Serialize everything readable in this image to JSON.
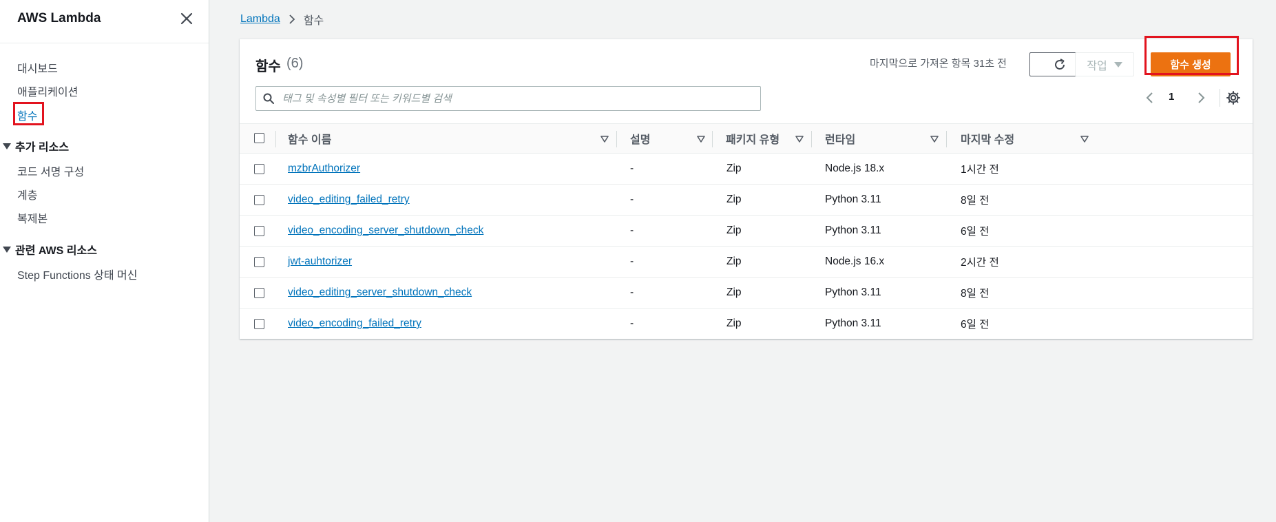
{
  "sidebar": {
    "title": "AWS Lambda",
    "items": [
      {
        "label": "대시보드"
      },
      {
        "label": "애플리케이션"
      },
      {
        "label": "함수"
      }
    ],
    "section_additional": {
      "label": "추가 리소스",
      "items": [
        {
          "label": "코드 서명 구성"
        },
        {
          "label": "계층"
        },
        {
          "label": "복제본"
        }
      ]
    },
    "section_related": {
      "label": "관련 AWS 리소스",
      "items": [
        {
          "label": "Step Functions 상태 머신"
        }
      ]
    }
  },
  "breadcrumb": {
    "root": "Lambda",
    "current": "함수"
  },
  "panel": {
    "title": "함수",
    "count": "(6)",
    "last_fetched": "마지막으로 가져온 항목 31초 전",
    "actions_label": "작업",
    "create_label": "함수 생성",
    "search_placeholder": "태그 및 속성별 필터 또는 키워드별 검색",
    "page": "1"
  },
  "table": {
    "columns": [
      "함수 이름",
      "설명",
      "패키지 유형",
      "런타임",
      "마지막 수정"
    ],
    "rows": [
      {
        "name": "mzbrAuthorizer",
        "description": "-",
        "package": "Zip",
        "runtime": "Node.js 18.x",
        "modified": "1시간 전"
      },
      {
        "name": "video_editing_failed_retry",
        "description": "-",
        "package": "Zip",
        "runtime": "Python 3.11",
        "modified": "8일 전"
      },
      {
        "name": "video_encoding_server_shutdown_check",
        "description": "-",
        "package": "Zip",
        "runtime": "Python 3.11",
        "modified": "6일 전"
      },
      {
        "name": "jwt-auhtorizer",
        "description": "-",
        "package": "Zip",
        "runtime": "Node.js 16.x",
        "modified": "2시간 전"
      },
      {
        "name": "video_editing_server_shutdown_check",
        "description": "-",
        "package": "Zip",
        "runtime": "Python 3.11",
        "modified": "8일 전"
      },
      {
        "name": "video_encoding_failed_retry",
        "description": "-",
        "package": "Zip",
        "runtime": "Python 3.11",
        "modified": "6일 전"
      }
    ]
  },
  "colors": {
    "link": "#0073bb",
    "primary_button": "#ec7211",
    "highlight_box": "#e2131e"
  }
}
